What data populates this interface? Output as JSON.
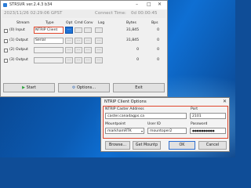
{
  "app": {
    "title": "STRSVR ver.2.4.3 b34",
    "timestamp": "2023/11/26 02:29:06 GPST",
    "connect_label": "Connect Time:",
    "connect_value": "0d 00:00:45",
    "controls": {
      "minimize": "–",
      "maximize": "□",
      "close": "✕"
    }
  },
  "table": {
    "headers": [
      "Stream",
      "Type",
      "Opt",
      "Cmd",
      "Conv",
      "Log",
      "Bytes",
      "Bps"
    ],
    "rows": [
      {
        "stream": "(0) Input",
        "type": "NTRIP Client",
        "opt": "...",
        "cmd": "",
        "conv": "",
        "log": "",
        "bytes": "31,845",
        "bps": "0"
      },
      {
        "stream": "(1) Output",
        "type": "Serial",
        "opt": "...",
        "cmd": "...",
        "conv": "...",
        "log": "...",
        "bytes": "31,845",
        "bps": "0"
      },
      {
        "stream": "(2) Output",
        "type": "",
        "opt": "...",
        "cmd": "...",
        "conv": "...",
        "log": "...",
        "bytes": "0",
        "bps": "0"
      },
      {
        "stream": "(3) Output",
        "type": "",
        "opt": "...",
        "cmd": "...",
        "conv": "...",
        "log": "...",
        "bytes": "0",
        "bps": "0"
      }
    ]
  },
  "buttons": {
    "start": "Start",
    "options": "Options...",
    "exit": "Exit"
  },
  "dialog": {
    "title": "NTRIP Client Options",
    "close": "✕",
    "caster_label": "NTRIP Caster Address",
    "caster_value": "caster.canadagps.ca",
    "port_label": "Port",
    "port_value": "2101",
    "mount_label": "Mountpoint",
    "mount_value": "markhamRTK",
    "user_label": "User ID",
    "user_value": "mountoper2",
    "pass_label": "Password",
    "pass_value": "●●●●●●●●●●",
    "browse": "Browse...",
    "get_mount": "Get Mountp",
    "ok": "OK",
    "cancel": "Cancel"
  },
  "colors": {
    "highlight": "#e0452a",
    "accent": "#1f73d6"
  }
}
